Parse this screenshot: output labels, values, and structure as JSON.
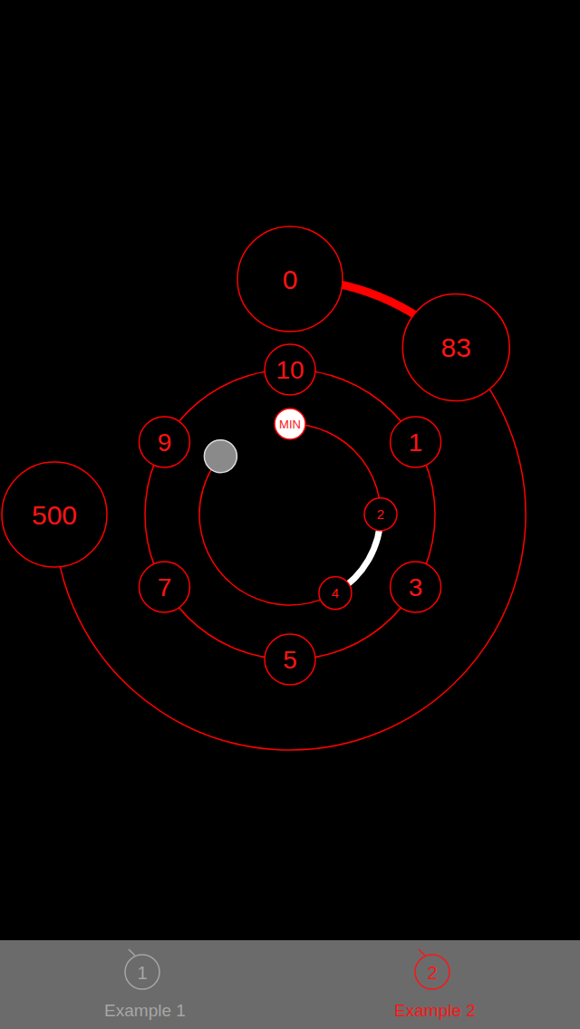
{
  "outer_slider": {
    "min_label": "0",
    "max_label": "500",
    "value_label": "83",
    "level": 0.166
  },
  "dial": {
    "labels": [
      "10",
      "1",
      "3",
      "5",
      "7",
      "9"
    ]
  },
  "inner_slider": {
    "min_label": "MIN",
    "low_label": "2",
    "high_label": "4",
    "low_level": 0.29,
    "high_level": 0.484,
    "avatar_level": 1
  },
  "tabs": [
    {
      "label": "Example 1",
      "icon": "1",
      "selected": false
    },
    {
      "label": "Example 2",
      "icon": "2",
      "selected": true
    }
  ]
}
